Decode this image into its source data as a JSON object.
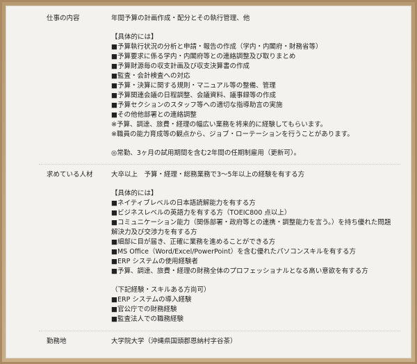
{
  "sections": [
    {
      "label": "仕事の内容",
      "lines": [
        "年間予算の計画作成・配分とその執行管理、他",
        "",
        "【具体的には】",
        "■予算執行状況の分析と申請・報告の作成（学内・内閣府・財務省等）",
        "■予算要求に係る学内・内閣府等との連絡調整及び取りまとめ",
        "■予算財源毎の収支計画及び収支決算書の作成",
        "■監査・会計検査への対応",
        "■予算・決算に関する規則・マニュアル等の整備、管理",
        "■予算関連会議の日程調整、会議資料、議事録等の作成",
        "■予算セクションのスタッフ等への適切な指導助言の実施",
        "■その他他部署との連絡調整",
        "※予算、調達、旅費・経理の幅広い業務を将来的に経験してもらいます。",
        "※職員の能力育成等の観点から、ジョブ・ローテーションを行うことがあります。",
        "",
        "◎常勤、3ヶ月の試用期間を含む2年間の任期制雇用（更新可）。"
      ]
    },
    {
      "label": "求めている人材",
      "lines": [
        "大卒以上　予算・経理・総務業務で3〜5年以上の経験を有する方",
        "",
        "【具体的には】",
        "■ネイティブレベルの日本語読解能力を有する方",
        "■ビジネスレベルの英語力を有する方（TOEIC800 点以上）",
        "■コミュニケーション能力（関係部署・政府等との連携・調整能力を言う。）を持ち優れた問題解決力及び交渉力を有する方",
        "■細部に目が届き、正確に業務を進めることができる方",
        "■MS Office（Word/Excel/PowerPoint）を含む優れたパソコンスキルを有する方",
        "■ERP システムの使用経験者",
        "■予算、調達、旅費・経理の財務全体のプロフェッショナルとなる高い意欲を有する方",
        "",
        "（下記経験・スキルある方尚可）",
        "■ERP システムの導入経験",
        "■官公庁での財務経験",
        "■監査法人での職務経験"
      ]
    },
    {
      "label": "勤務地",
      "lines": [
        "大学院大学（沖縄県国頭郡恩納村字谷茶）"
      ]
    }
  ]
}
